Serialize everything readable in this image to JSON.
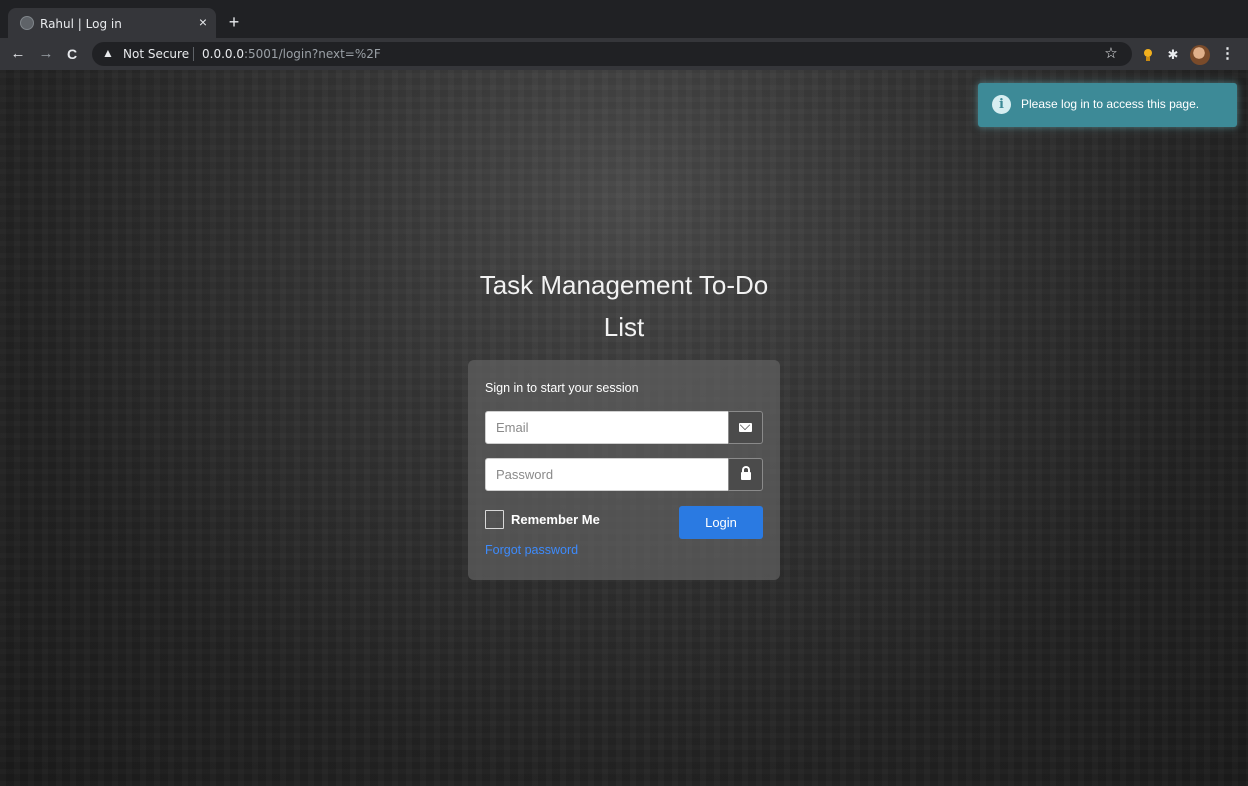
{
  "browser": {
    "tab_title": "Rahul | Log in",
    "tab_close": "×",
    "new_tab": "+",
    "security_label": "Not Secure",
    "url_host": "0.0.0.0",
    "url_rest": ":5001/login?next=%2F",
    "icons": [
      "back-icon",
      "forward-icon",
      "reload-icon",
      "warning-icon",
      "star-icon",
      "extension-icon",
      "puzzle-icon",
      "profile-avatar",
      "menu-icon"
    ]
  },
  "toast": {
    "message": "Please log in to access this page.",
    "icon_glyph": "i",
    "color": "#3d8a97"
  },
  "app": {
    "title_line1": "Task Management To-Do",
    "title_line2": "List"
  },
  "login": {
    "message": "Sign in to start your session",
    "email_placeholder": "Email",
    "email_value": "",
    "password_placeholder": "Password",
    "password_value": "",
    "remember_label": "Remember Me",
    "remember_checked": false,
    "login_button": "Login",
    "forgot_link": "Forgot password",
    "accent": "#2a7ae2",
    "link_color": "#3d8bfd"
  }
}
